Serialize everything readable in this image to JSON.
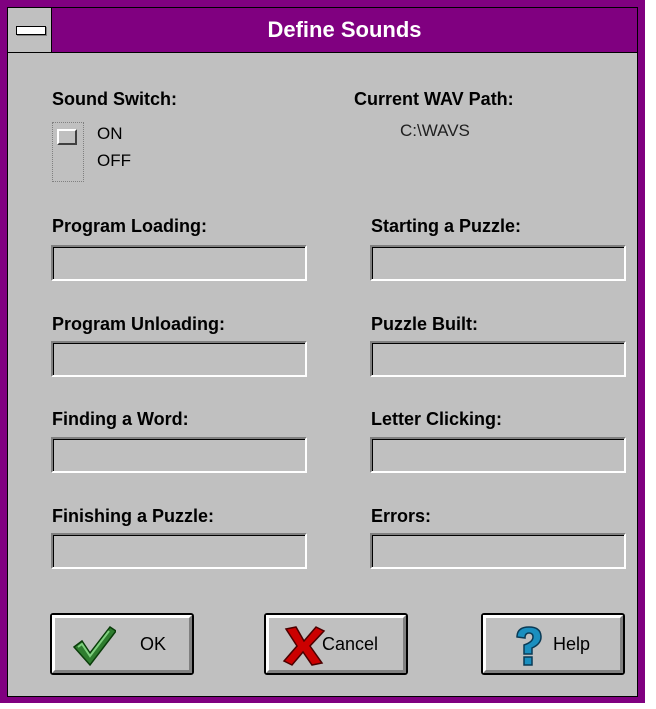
{
  "window": {
    "title": "Define Sounds"
  },
  "sound_switch": {
    "label": "Sound Switch:",
    "on_label": "ON",
    "off_label": "OFF"
  },
  "wav_path": {
    "label": "Current WAV Path:",
    "value": "C:\\WAVS"
  },
  "fields": {
    "program_loading": {
      "label": "Program Loading:",
      "value": ""
    },
    "starting_puzzle": {
      "label": "Starting a Puzzle:",
      "value": ""
    },
    "program_unloading": {
      "label": "Program Unloading:",
      "value": ""
    },
    "puzzle_built": {
      "label": "Puzzle Built:",
      "value": ""
    },
    "finding_word": {
      "label": "Finding a Word:",
      "value": ""
    },
    "letter_clicking": {
      "label": "Letter Clicking:",
      "value": ""
    },
    "finishing_puzzle": {
      "label": "Finishing a Puzzle:",
      "value": ""
    },
    "errors": {
      "label": "Errors:",
      "value": ""
    }
  },
  "buttons": {
    "ok": {
      "label": "OK",
      "icon": "checkmark-icon",
      "color": "#2f7d2f"
    },
    "cancel": {
      "label": "Cancel",
      "icon": "red-x-icon",
      "color": "#cc0000"
    },
    "help": {
      "label": "Help",
      "icon": "question-mark-icon",
      "color": "#1a8fbf"
    }
  }
}
